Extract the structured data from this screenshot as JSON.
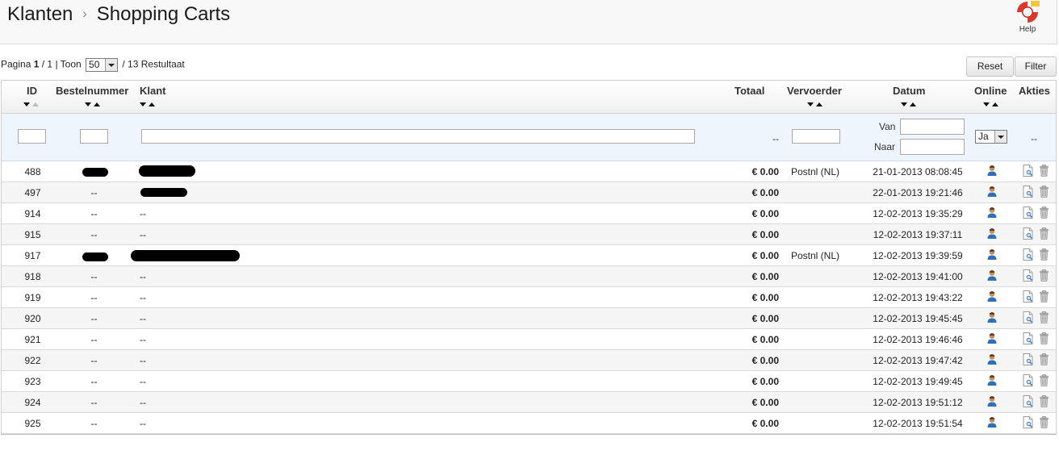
{
  "breadcrumb": {
    "parent": "Klanten",
    "separator": "›",
    "current": "Shopping Carts"
  },
  "help": {
    "label": "Help"
  },
  "pagination": {
    "prefix": "Pagina",
    "current": "1",
    "total": "/ 1",
    "show_label": "| Toon",
    "per_page": "50",
    "results": "/ 13 Restultaat"
  },
  "buttons": {
    "reset": "Reset",
    "filter": "Filter"
  },
  "columns": {
    "id": "ID",
    "order": "Bestelnummer",
    "customer": "Klant",
    "total": "Totaal",
    "carrier": "Vervoerder",
    "date": "Datum",
    "online": "Online",
    "actions": "Akties"
  },
  "filters": {
    "total_dash": "--",
    "date_from_label": "Van",
    "date_to_label": "Naar",
    "online_value": "Ja",
    "actions_dash": "--"
  },
  "rows": [
    {
      "id": "488",
      "order": "",
      "customer": "",
      "total": "€ 0.00",
      "carrier": "Postnl (NL)",
      "date": "21-01-2013 08:08:45"
    },
    {
      "id": "497",
      "order": "--",
      "customer": "",
      "total": "€ 0.00",
      "carrier": "",
      "date": "22-01-2013 19:21:46"
    },
    {
      "id": "914",
      "order": "--",
      "customer": "--",
      "total": "€ 0.00",
      "carrier": "",
      "date": "12-02-2013 19:35:29"
    },
    {
      "id": "915",
      "order": "--",
      "customer": "--",
      "total": "€ 0.00",
      "carrier": "",
      "date": "12-02-2013 19:37:11"
    },
    {
      "id": "917",
      "order": "",
      "customer": "",
      "total": "€ 0.00",
      "carrier": "Postnl (NL)",
      "date": "12-02-2013 19:39:59"
    },
    {
      "id": "918",
      "order": "--",
      "customer": "--",
      "total": "€ 0.00",
      "carrier": "",
      "date": "12-02-2013 19:41:00"
    },
    {
      "id": "919",
      "order": "--",
      "customer": "--",
      "total": "€ 0.00",
      "carrier": "",
      "date": "12-02-2013 19:43:22"
    },
    {
      "id": "920",
      "order": "--",
      "customer": "--",
      "total": "€ 0.00",
      "carrier": "",
      "date": "12-02-2013 19:45:45"
    },
    {
      "id": "921",
      "order": "--",
      "customer": "--",
      "total": "€ 0.00",
      "carrier": "",
      "date": "12-02-2013 19:46:46"
    },
    {
      "id": "922",
      "order": "--",
      "customer": "--",
      "total": "€ 0.00",
      "carrier": "",
      "date": "12-02-2013 19:47:42"
    },
    {
      "id": "923",
      "order": "--",
      "customer": "--",
      "total": "€ 0.00",
      "carrier": "",
      "date": "12-02-2013 19:49:45"
    },
    {
      "id": "924",
      "order": "--",
      "customer": "--",
      "total": "€ 0.00",
      "carrier": "",
      "date": "12-02-2013 19:51:12"
    },
    {
      "id": "925",
      "order": "--",
      "customer": "--",
      "total": "€ 0.00",
      "carrier": "",
      "date": "12-02-2013 19:51:54"
    }
  ],
  "row_icons": {
    "online": "customer-icon",
    "view": "view-details-icon",
    "delete": "delete-bin-icon"
  }
}
